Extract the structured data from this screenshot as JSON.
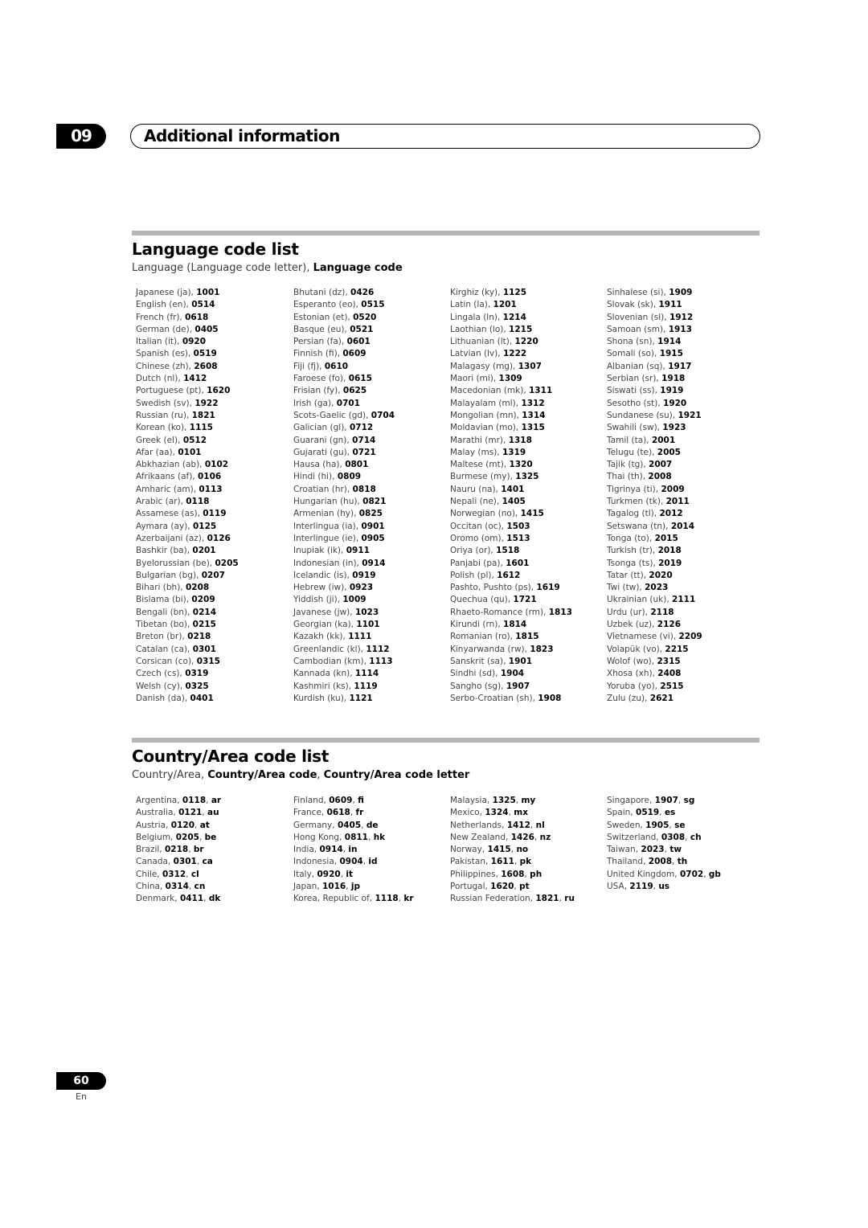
{
  "chapter": {
    "number": "09",
    "title": "Additional information"
  },
  "language_section": {
    "title": "Language code list",
    "subtitle_plain": "Language (Language code letter), ",
    "subtitle_bold": "Language code",
    "columns": [
      [
        [
          "Japanese (ja), ",
          "1001"
        ],
        [
          "English (en), ",
          "0514"
        ],
        [
          "French (fr), ",
          "0618"
        ],
        [
          "German (de), ",
          "0405"
        ],
        [
          "Italian (it), ",
          "0920"
        ],
        [
          "Spanish (es), ",
          "0519"
        ],
        [
          "Chinese (zh), ",
          "2608"
        ],
        [
          "Dutch (nl), ",
          "1412"
        ],
        [
          "Portuguese (pt), ",
          "1620"
        ],
        [
          "Swedish (sv), ",
          "1922"
        ],
        [
          "Russian (ru), ",
          "1821"
        ],
        [
          "Korean (ko), ",
          "1115"
        ],
        [
          "Greek (el), ",
          "0512"
        ],
        [
          "Afar (aa), ",
          "0101"
        ],
        [
          "Abkhazian (ab), ",
          "0102"
        ],
        [
          "Afrikaans (af), ",
          "0106"
        ],
        [
          "Amharic (am), ",
          "0113"
        ],
        [
          "Arabic (ar), ",
          "0118"
        ],
        [
          "Assamese (as), ",
          "0119"
        ],
        [
          "Aymara (ay), ",
          "0125"
        ],
        [
          "Azerbaijani (az), ",
          "0126"
        ],
        [
          "Bashkir (ba), ",
          "0201"
        ],
        [
          "Byelorussian (be), ",
          "0205"
        ],
        [
          "Bulgarian (bg), ",
          "0207"
        ],
        [
          "Bihari (bh), ",
          "0208"
        ],
        [
          "Bislama (bi), ",
          "0209"
        ],
        [
          "Bengali (bn), ",
          "0214"
        ],
        [
          "Tibetan (bo), ",
          "0215"
        ],
        [
          "Breton (br), ",
          "0218"
        ],
        [
          "Catalan (ca), ",
          "0301"
        ],
        [
          "Corsican (co), ",
          "0315"
        ],
        [
          "Czech (cs), ",
          "0319"
        ],
        [
          "Welsh (cy), ",
          "0325"
        ],
        [
          "Danish (da), ",
          "0401"
        ]
      ],
      [
        [
          "Bhutani (dz), ",
          "0426"
        ],
        [
          "Esperanto (eo), ",
          "0515"
        ],
        [
          "Estonian (et), ",
          "0520"
        ],
        [
          "Basque (eu), ",
          "0521"
        ],
        [
          "Persian (fa), ",
          "0601"
        ],
        [
          "Finnish (fi), ",
          "0609"
        ],
        [
          "Fiji (fj), ",
          "0610"
        ],
        [
          "Faroese (fo), ",
          "0615"
        ],
        [
          "Frisian (fy), ",
          "0625"
        ],
        [
          "Irish (ga), ",
          "0701"
        ],
        [
          "Scots-Gaelic (gd), ",
          "0704"
        ],
        [
          "Galician (gl), ",
          "0712"
        ],
        [
          "Guarani (gn), ",
          "0714"
        ],
        [
          "Gujarati (gu), ",
          "0721"
        ],
        [
          "Hausa (ha), ",
          "0801"
        ],
        [
          "Hindi (hi), ",
          "0809"
        ],
        [
          "Croatian (hr), ",
          "0818"
        ],
        [
          "Hungarian (hu), ",
          "0821"
        ],
        [
          "Armenian (hy), ",
          "0825"
        ],
        [
          "Interlingua (ia), ",
          "0901"
        ],
        [
          "Interlingue (ie), ",
          "0905"
        ],
        [
          "Inupiak (ik), ",
          "0911"
        ],
        [
          "Indonesian (in), ",
          "0914"
        ],
        [
          "Icelandic (is), ",
          "0919"
        ],
        [
          "Hebrew (iw), ",
          "0923"
        ],
        [
          "Yiddish (ji), ",
          "1009"
        ],
        [
          "Javanese (jw), ",
          "1023"
        ],
        [
          "Georgian (ka), ",
          "1101"
        ],
        [
          "Kazakh (kk), ",
          "1111"
        ],
        [
          "Greenlandic  (kl), ",
          "1112"
        ],
        [
          "Cambodian (km), ",
          "1113"
        ],
        [
          "Kannada (kn), ",
          "1114"
        ],
        [
          "Kashmiri (ks), ",
          "1119"
        ],
        [
          "Kurdish (ku), ",
          "1121"
        ]
      ],
      [
        [
          "Kirghiz (ky), ",
          "1125"
        ],
        [
          "Latin (la), ",
          "1201"
        ],
        [
          "Lingala (ln), ",
          "1214"
        ],
        [
          "Laothian (lo), ",
          "1215"
        ],
        [
          "Lithuanian (lt), ",
          "1220"
        ],
        [
          "Latvian (lv), ",
          "1222"
        ],
        [
          "Malagasy (mg), ",
          "1307"
        ],
        [
          "Maori (mi), ",
          "1309"
        ],
        [
          "Macedonian (mk), ",
          "1311"
        ],
        [
          "Malayalam  (ml), ",
          "1312"
        ],
        [
          "Mongolian (mn), ",
          "1314"
        ],
        [
          "Moldavian (mo), ",
          "1315"
        ],
        [
          "Marathi (mr), ",
          "1318"
        ],
        [
          "Malay  (ms), ",
          "1319"
        ],
        [
          "Maltese (mt), ",
          "1320"
        ],
        [
          "Burmese (my), ",
          "1325"
        ],
        [
          "Nauru (na), ",
          "1401"
        ],
        [
          "Nepali (ne), ",
          "1405"
        ],
        [
          "Norwegian (no), ",
          "1415"
        ],
        [
          "Occitan (oc), ",
          "1503"
        ],
        [
          "Oromo (om), ",
          "1513"
        ],
        [
          "Oriya (or), ",
          "1518"
        ],
        [
          "Panjabi (pa), ",
          "1601"
        ],
        [
          "Polish (pl), ",
          "1612"
        ],
        [
          "Pashto, Pushto (ps), ",
          "1619"
        ],
        [
          "Quechua (qu), ",
          "1721"
        ],
        [
          "Rhaeto-Romance (rm), ",
          "1813"
        ],
        [
          "Kirundi (rn), ",
          "1814"
        ],
        [
          "Romanian (ro), ",
          "1815"
        ],
        [
          "Kinyarwanda (rw), ",
          "1823"
        ],
        [
          "Sanskrit (sa), ",
          "1901"
        ],
        [
          "Sindhi (sd), ",
          "1904"
        ],
        [
          "Sangho (sg), ",
          "1907"
        ],
        [
          "Serbo-Croatian (sh), ",
          "1908"
        ]
      ],
      [
        [
          "Sinhalese (si), ",
          "1909"
        ],
        [
          "Slovak (sk), ",
          "1911"
        ],
        [
          "Slovenian (sl), ",
          "1912"
        ],
        [
          "Samoan (sm), ",
          "1913"
        ],
        [
          "Shona (sn), ",
          "1914"
        ],
        [
          "Somali (so), ",
          "1915"
        ],
        [
          "Albanian (sq), ",
          "1917"
        ],
        [
          "Serbian (sr), ",
          "1918"
        ],
        [
          "Siswati (ss), ",
          "1919"
        ],
        [
          "Sesotho (st), ",
          "1920"
        ],
        [
          "Sundanese (su), ",
          "1921"
        ],
        [
          "Swahili (sw), ",
          "1923"
        ],
        [
          "Tamil (ta), ",
          "2001"
        ],
        [
          "Telugu (te), ",
          "2005"
        ],
        [
          "Tajik (tg), ",
          "2007"
        ],
        [
          "Thai (th), ",
          "2008"
        ],
        [
          "Tigrinya (ti), ",
          "2009"
        ],
        [
          "Turkmen (tk), ",
          "2011"
        ],
        [
          "Tagalog (tl), ",
          "2012"
        ],
        [
          "Setswana (tn), ",
          "2014"
        ],
        [
          "Tonga (to), ",
          "2015"
        ],
        [
          "Turkish (tr), ",
          "2018"
        ],
        [
          "Tsonga (ts), ",
          "2019"
        ],
        [
          "Tatar (tt), ",
          "2020"
        ],
        [
          "Twi (tw), ",
          "2023"
        ],
        [
          "Ukrainian (uk), ",
          "2111"
        ],
        [
          "Urdu (ur), ",
          "2118"
        ],
        [
          "Uzbek (uz), ",
          "2126"
        ],
        [
          "Vietnamese (vi), ",
          "2209"
        ],
        [
          "Volapük (vo), ",
          "2215"
        ],
        [
          "Wolof (wo), ",
          "2315"
        ],
        [
          "Xhosa (xh), ",
          "2408"
        ],
        [
          "Yoruba (yo), ",
          "2515"
        ],
        [
          "Zulu (zu), ",
          "2621"
        ]
      ]
    ]
  },
  "country_section": {
    "title": "Country/Area code list",
    "subtitle_plain": "Country/Area, ",
    "subtitle_bold1": "Country/Area code",
    "subtitle_sep": ", ",
    "subtitle_bold2": "Country/Area code letter",
    "columns": [
      [
        [
          "Argentina, ",
          "0118",
          "ar"
        ],
        [
          "Australia, ",
          "0121",
          "au"
        ],
        [
          "Austria, ",
          "0120",
          "at"
        ],
        [
          "Belgium, ",
          "0205",
          "be"
        ],
        [
          "Brazil, ",
          "0218",
          "br"
        ],
        [
          "Canada, ",
          "0301",
          "ca"
        ],
        [
          "Chile, ",
          "0312",
          "cl"
        ],
        [
          "China, ",
          "0314",
          "cn"
        ],
        [
          "Denmark, ",
          "0411",
          "dk"
        ]
      ],
      [
        [
          "Finland, ",
          "0609",
          "fi"
        ],
        [
          "France, ",
          "0618",
          "fr"
        ],
        [
          "Germany, ",
          "0405",
          "de"
        ],
        [
          "Hong Kong, ",
          "0811",
          "hk"
        ],
        [
          "India, ",
          "0914",
          "in"
        ],
        [
          "Indonesia, ",
          "0904",
          "id"
        ],
        [
          "Italy, ",
          "0920",
          "it"
        ],
        [
          "Japan, ",
          "1016",
          "jp"
        ],
        [
          "Korea, Republic of, ",
          "1118",
          "kr"
        ]
      ],
      [
        [
          "Malaysia, ",
          "1325",
          "my"
        ],
        [
          "Mexico, ",
          "1324",
          "mx"
        ],
        [
          "Netherlands, ",
          "1412",
          "nl"
        ],
        [
          "New Zealand, ",
          "1426",
          "nz"
        ],
        [
          "Norway, ",
          "1415",
          "no"
        ],
        [
          "Pakistan, ",
          "1611",
          "pk"
        ],
        [
          "Philippines, ",
          "1608",
          "ph"
        ],
        [
          "Portugal, ",
          "1620",
          "pt"
        ],
        [
          "Russian Federation, ",
          "1821",
          "ru"
        ]
      ],
      [
        [
          "Singapore, ",
          "1907",
          "sg"
        ],
        [
          "Spain, ",
          "0519",
          "es"
        ],
        [
          "Sweden, ",
          "1905",
          "se"
        ],
        [
          "Switzerland, ",
          "0308",
          "ch"
        ],
        [
          "Taiwan, ",
          "2023",
          "tw"
        ],
        [
          "Thailand, ",
          "2008",
          "th"
        ],
        [
          "United Kingdom, ",
          "0702",
          "gb"
        ],
        [
          "USA, ",
          "2119",
          "us"
        ]
      ]
    ]
  },
  "footer": {
    "page_number": "60",
    "language": "En"
  }
}
